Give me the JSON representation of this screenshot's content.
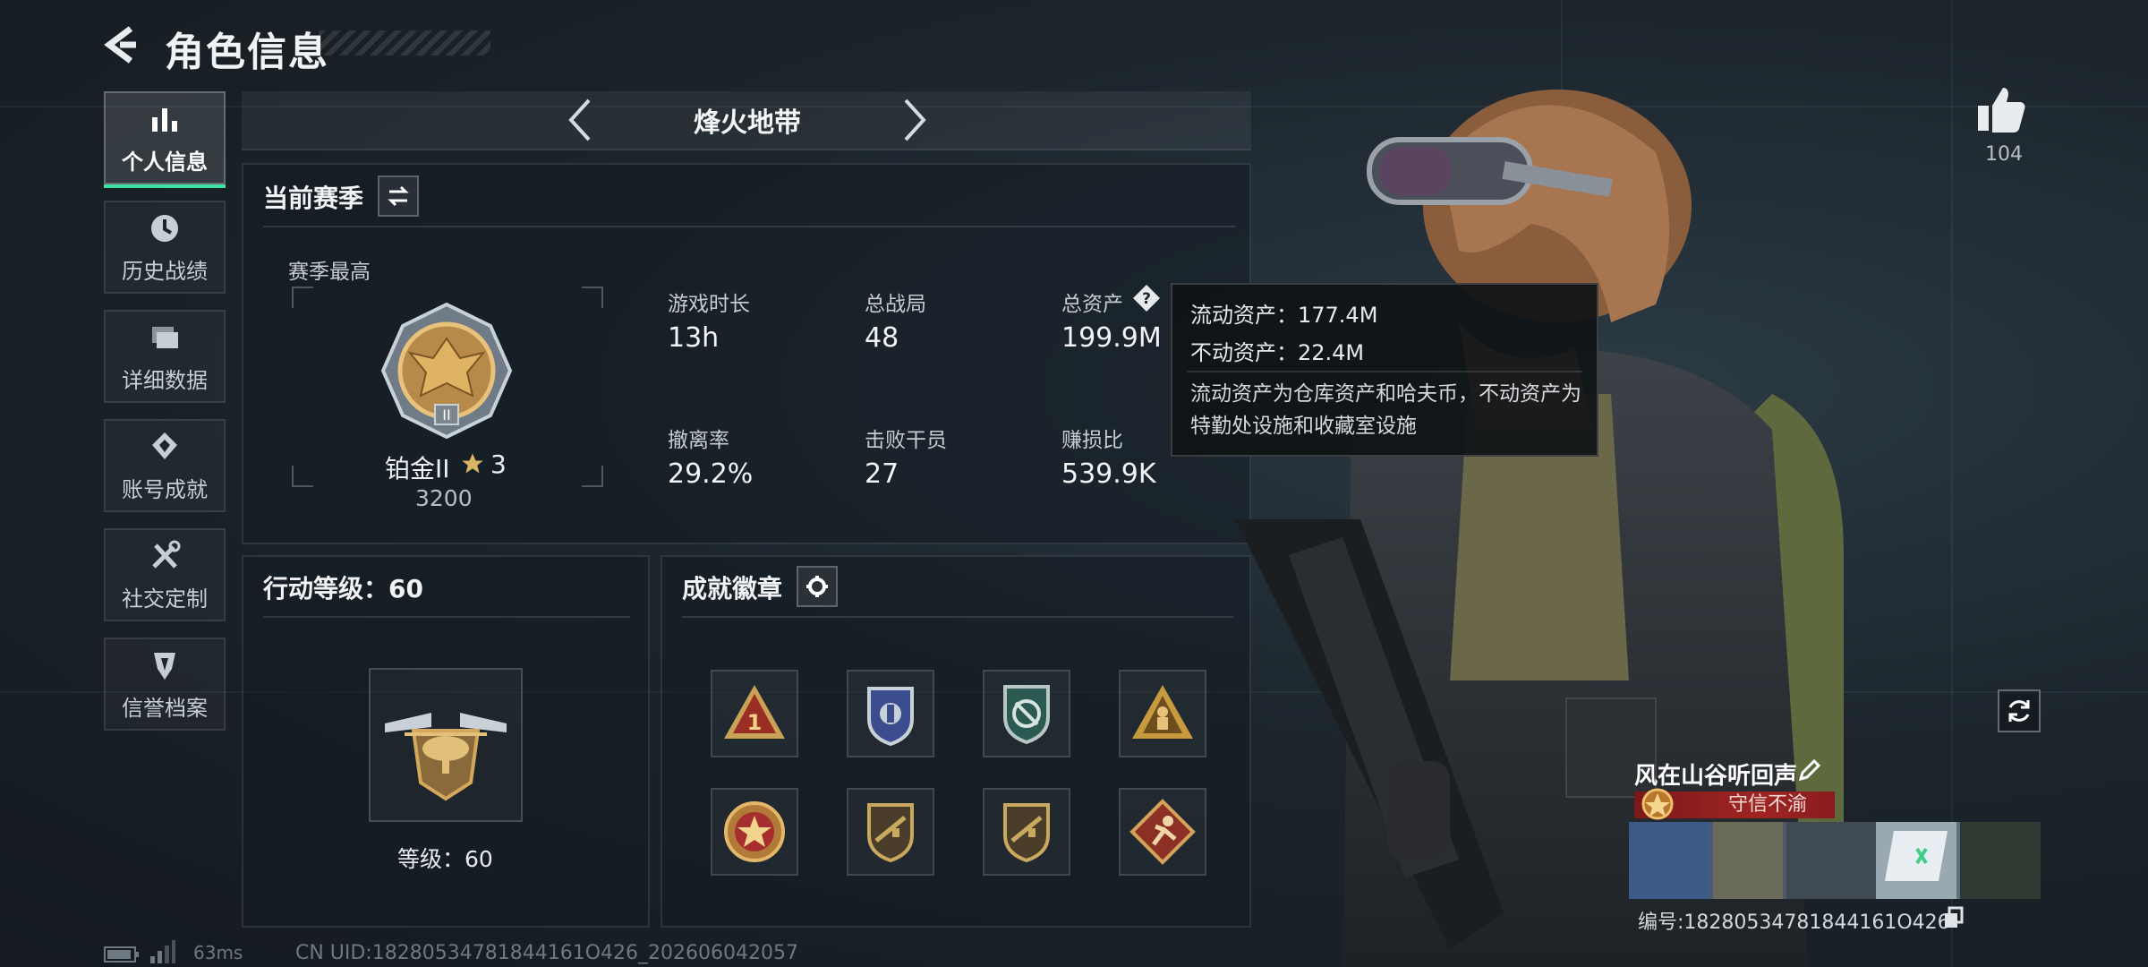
{
  "header": {
    "title": "角色信息"
  },
  "sidebar": {
    "items": [
      {
        "label": "个人信息",
        "icon": "bar-chart-icon",
        "active": true
      },
      {
        "label": "历史战绩",
        "icon": "history-clock-icon",
        "active": false
      },
      {
        "label": "详细数据",
        "icon": "folders-icon",
        "active": false
      },
      {
        "label": "账号成就",
        "icon": "achievement-icon",
        "active": false
      },
      {
        "label": "社交定制",
        "icon": "tools-icon",
        "active": false
      },
      {
        "label": "信誉档案",
        "icon": "credit-shield-icon",
        "active": false
      }
    ]
  },
  "mode_selector": {
    "title": "烽火地带"
  },
  "season": {
    "heading": "当前赛季",
    "best_label": "赛季最高",
    "rank_name": "铂金II",
    "rank_stars": "3",
    "rank_points": "3200",
    "stats": [
      {
        "label": "游戏时长",
        "value": "13h"
      },
      {
        "label": "总战局",
        "value": "48"
      },
      {
        "label": "总资产",
        "value": "199.9M"
      },
      {
        "label": "撤离率",
        "value": "29.2%"
      },
      {
        "label": "击败干员",
        "value": "27"
      },
      {
        "label": "赚损比",
        "value": "539.9K"
      }
    ]
  },
  "tooltip": {
    "liquid": "流动资产：177.4M",
    "fixed": "不动资产：22.4M",
    "note": "流动资产为仓库资产和哈夫币，不动资产为特勤处设施和收藏室设施"
  },
  "action_level": {
    "heading": "行动等级：60",
    "level_text": "等级：60"
  },
  "badges": {
    "heading": "成就徽章",
    "items": [
      {
        "icon": "red-triangle-one-badge-icon"
      },
      {
        "icon": "blue-shield-badge-icon"
      },
      {
        "icon": "green-crest-badge-icon"
      },
      {
        "icon": "golden-soldier-triangle-badge-icon"
      },
      {
        "icon": "star-medal-badge-icon"
      },
      {
        "icon": "rifle-shield-badge-icon"
      },
      {
        "icon": "rifle-shield-badge-icon-2"
      },
      {
        "icon": "runner-diamond-badge-icon"
      }
    ]
  },
  "likes": {
    "count": "104"
  },
  "player": {
    "name": "风在山谷听回声",
    "title": "守信不渝",
    "uid_line": "编号:18280534781844161O426"
  },
  "status": {
    "latency": "63ms",
    "cn_uid": "CN UID:18280534781844161O426_202606042057"
  },
  "colors": {
    "accent": "#3ee0a6",
    "title_banner": "#a02424",
    "background": "#1c252c"
  }
}
